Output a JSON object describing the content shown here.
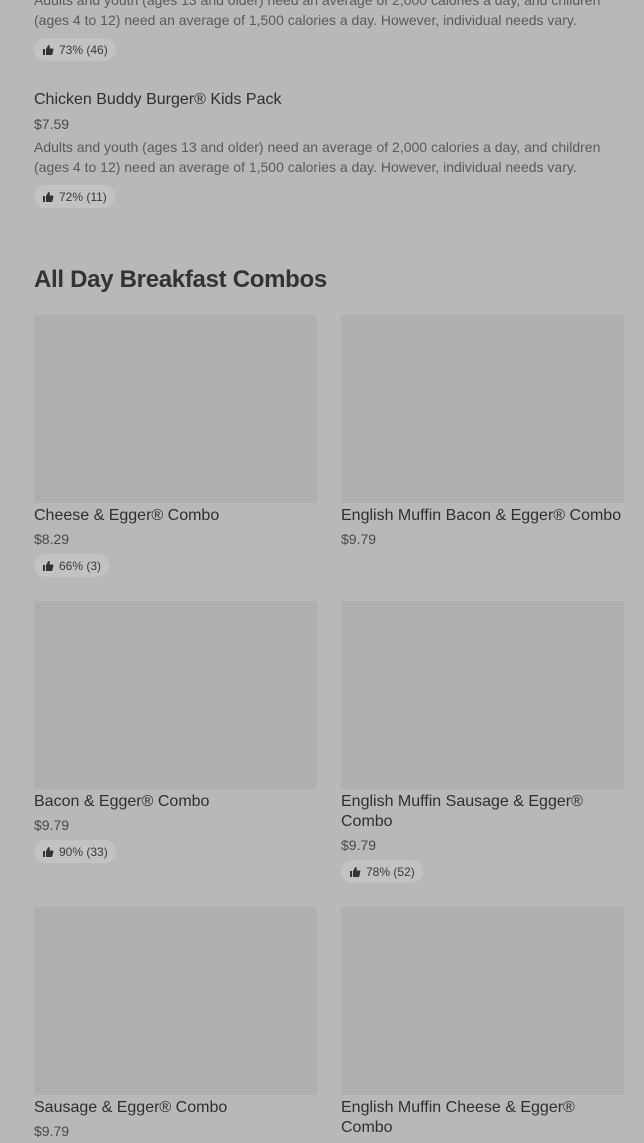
{
  "prev_item": {
    "desc": "Adults and youth (ages 13 and older) need an average of 2,000 calories a day, and children (ages 4 to 12) need an average of 1,500 calories a day. However, individual needs vary.",
    "rating": "73% (46)"
  },
  "kids_pack": {
    "title": "Chicken Buddy Burger® Kids Pack",
    "price": "$7.59",
    "desc": "Adults and youth (ages 13 and older) need an average of 2,000 calories a day, and children (ages 4 to 12) need an average of 1,500 calories a day. However, individual needs vary.",
    "rating": "72% (11)"
  },
  "section": {
    "title": "All Day Breakfast Combos"
  },
  "cards": [
    {
      "title": "Cheese & Egger® Combo",
      "price": "$8.29",
      "rating": "66% (3)"
    },
    {
      "title": "English Muffin Bacon & Egger® Combo",
      "price": "$9.79"
    },
    {
      "title": "Bacon & Egger® Combo",
      "price": "$9.79",
      "rating": "90% (33)"
    },
    {
      "title": "English Muffin Sausage & Egger® Combo",
      "price": "$9.79",
      "rating": "78% (52)"
    },
    {
      "title": "Sausage & Egger® Combo",
      "price": "$9.79"
    },
    {
      "title": "English Muffin Cheese & Egger® Combo"
    }
  ],
  "icons": {
    "rating": "thumbs-up-icon"
  },
  "colors": {
    "overlay_background": "#b8b8b8",
    "image_placeholder": "#afafaf",
    "rating_pill": "#c2c2c2"
  }
}
